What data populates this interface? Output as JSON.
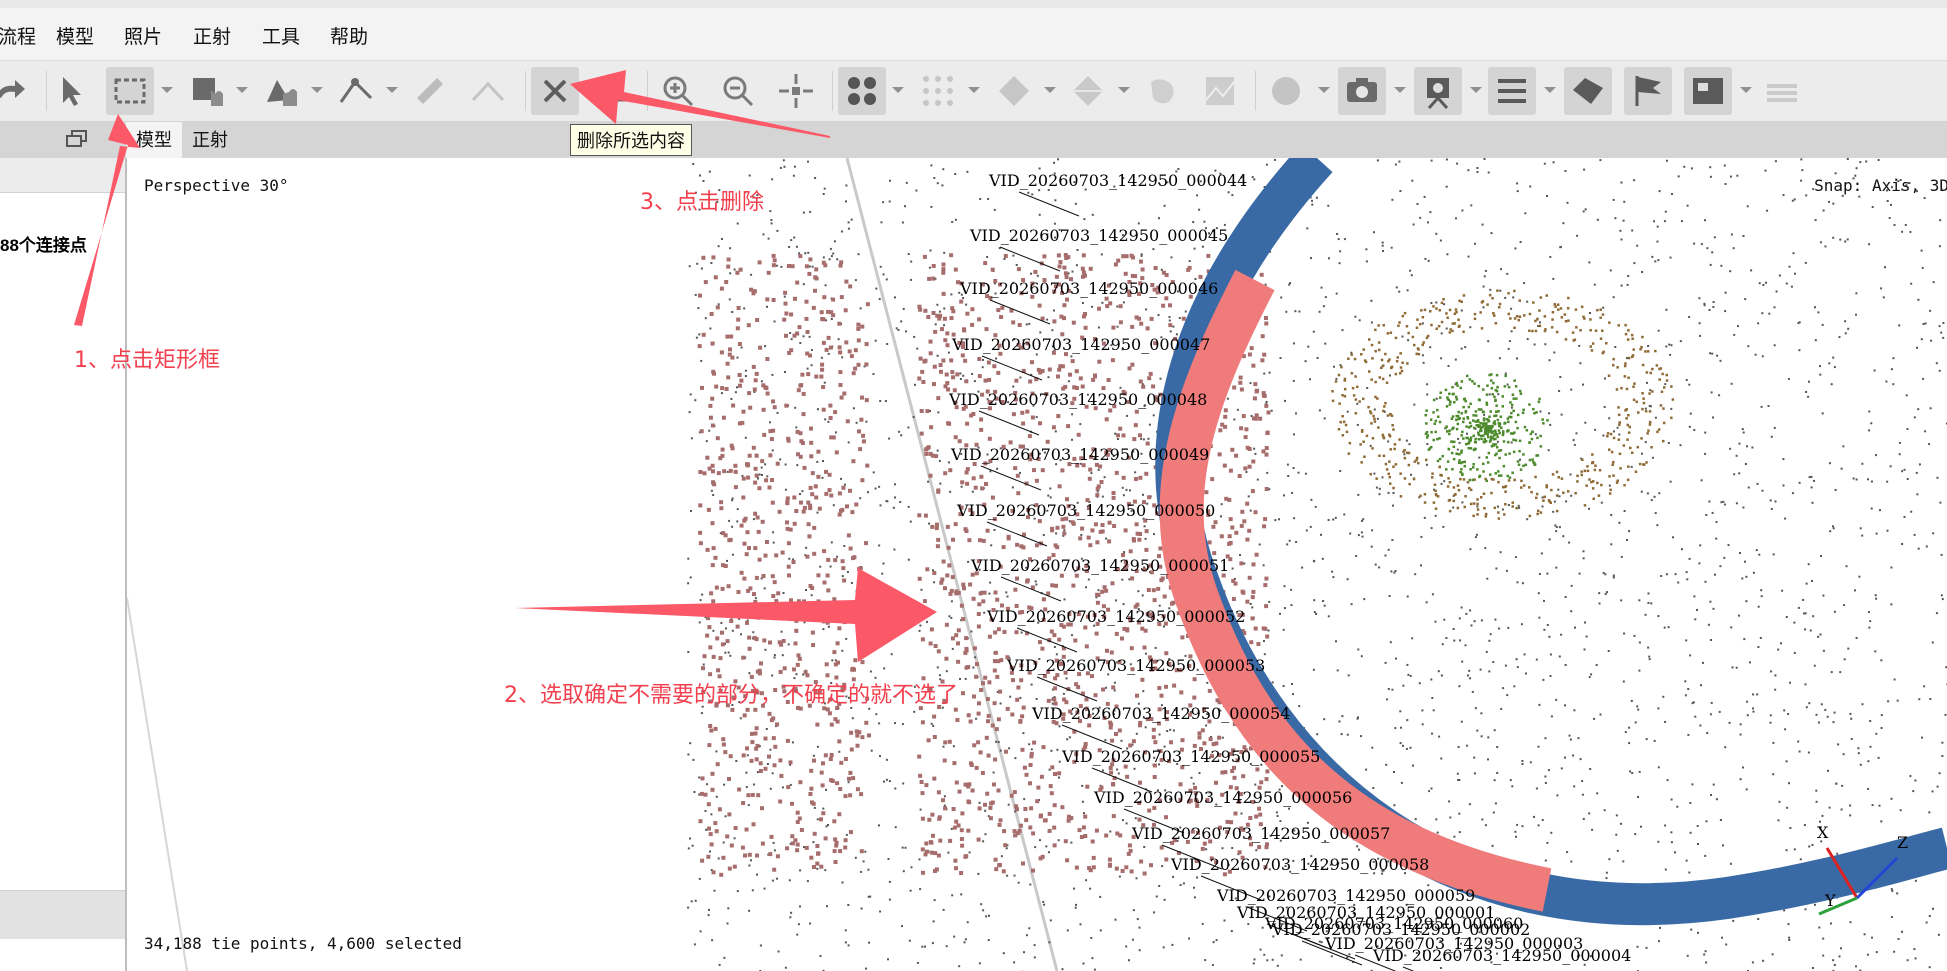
{
  "menu": {
    "items": [
      "流程",
      "模型",
      "照片",
      "正射",
      "工具",
      "帮助"
    ]
  },
  "toolbar": {
    "tools": [
      {
        "icon": "redo-icon"
      },
      {
        "icon": "select-arrow-icon"
      },
      {
        "icon": "rectangle-selection-icon"
      },
      {
        "icon": "free-form-selection-icon"
      },
      {
        "icon": "navigation-hand-icon"
      },
      {
        "icon": "ruler-icon"
      },
      {
        "icon": "shape-draw-icon"
      },
      {
        "icon": "measure-line-icon"
      },
      {
        "icon": "delete-selection-icon"
      },
      {
        "icon": "crop-icon"
      },
      {
        "icon": "zoom-in-icon"
      },
      {
        "icon": "zoom-out-icon"
      },
      {
        "icon": "reset-view-icon"
      },
      {
        "icon": "points-view-icon"
      },
      {
        "icon": "dense-cloud-icon"
      },
      {
        "icon": "mesh-icon"
      },
      {
        "icon": "textured-mesh-icon"
      },
      {
        "icon": "tiled-model-icon"
      },
      {
        "icon": "dem-icon"
      },
      {
        "icon": "globe-icon"
      },
      {
        "icon": "camera-icon"
      },
      {
        "icon": "video-camera-icon"
      },
      {
        "icon": "layers-icon"
      },
      {
        "icon": "shapes-icon"
      },
      {
        "icon": "markers-flag-icon"
      },
      {
        "icon": "image-icon"
      },
      {
        "icon": "stack-icon"
      }
    ]
  },
  "tabs": {
    "model": "模型",
    "ortho": "正射"
  },
  "tooltip": "删除所选内容",
  "left_panel": {
    "item": "88个连接点"
  },
  "viewport": {
    "projection": "Perspective 30°",
    "snap": "Snap: Axis, 3D",
    "status": "34,188 tie points, 4,600 selected",
    "cameras": [
      "VID_20260703_142950_000044",
      "VID_20260703_142950_000045",
      "VID_20260703_142950_000046",
      "VID_20260703_142950_000047",
      "VID_20260703_142950_000048",
      "VID_20260703_142950_000049",
      "VID_20260703_142950_000050",
      "VID_20260703_142950_000051",
      "VID_20260703_142950_000052",
      "VID_20260703_142950_000053",
      "VID_20260703_142950_000054",
      "VID_20260703_142950_000055",
      "VID_20260703_142950_000056",
      "VID_20260703_142950_000057",
      "VID_20260703_142950_000058",
      "VID_20260703_142950_000059",
      "VID_20260703_142950_000001",
      "VID_20260703_142950_000060",
      "VID_20260703_142950_000002",
      "VID_20260703_142950_000003",
      "VID_20260703_142950_000004"
    ],
    "axes": {
      "x": "X",
      "y": "Y",
      "z": "Z"
    }
  },
  "annotations": {
    "step1": "1、点击矩形框",
    "step2": "2、选取确定不需要的部分，不确定的就不选了",
    "step3": "3、点击删除"
  },
  "colors": {
    "annotation": "#f2404f",
    "selected_points": "#a76d6d",
    "track_blue": "#3a6aa5",
    "track_selected": "#f07b7b",
    "sparse_points": "#555555",
    "green_cluster": "#4d8a2c",
    "brown_cluster": "#8f6a35"
  }
}
